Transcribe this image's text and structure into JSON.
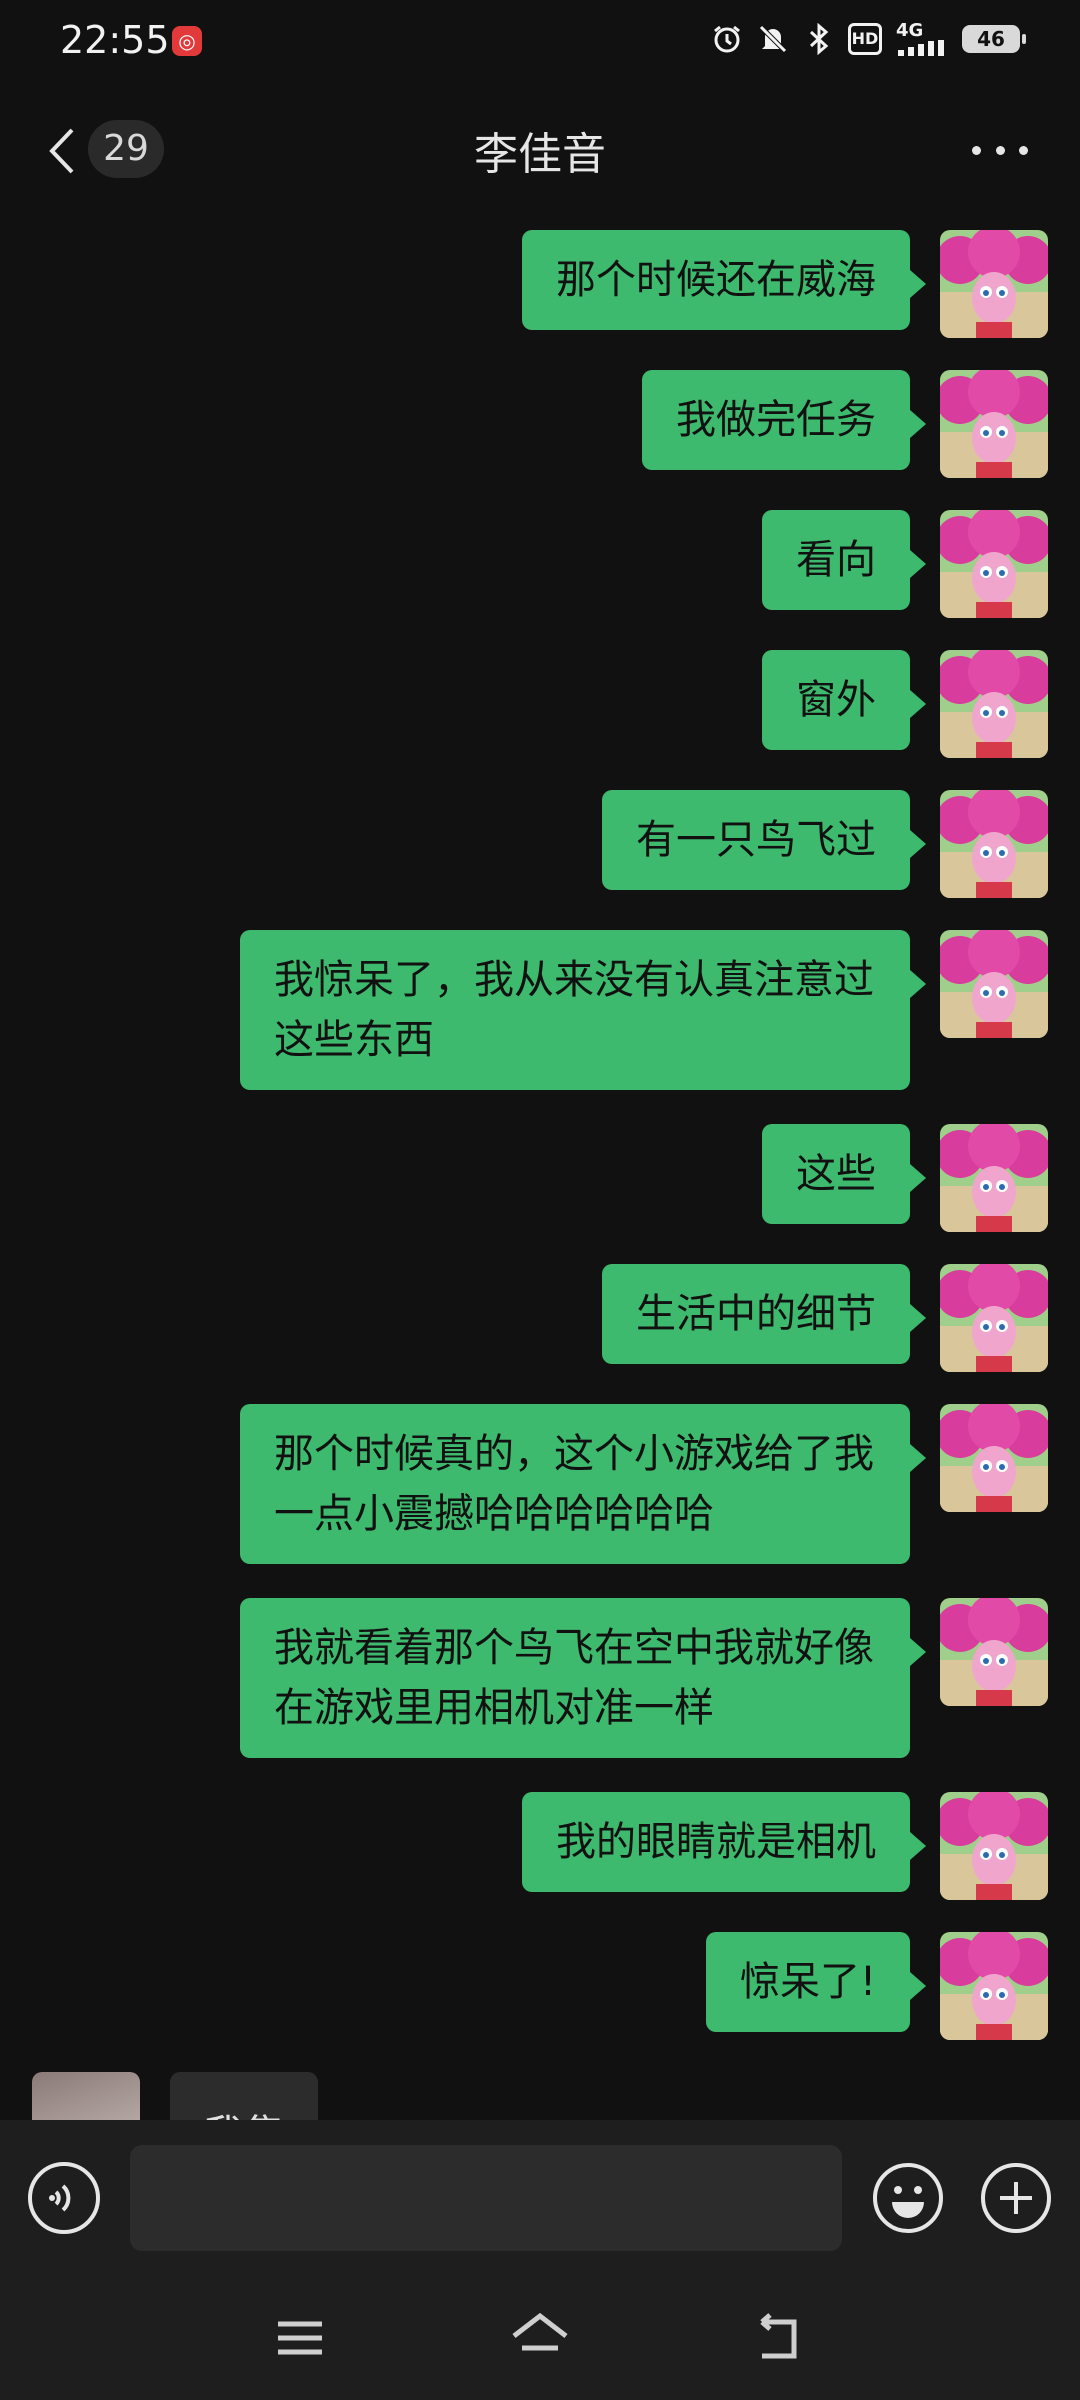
{
  "status_bar": {
    "time": "22:55",
    "network": "4G",
    "hd": "HD",
    "battery": "46"
  },
  "header": {
    "unread_count": "29",
    "title": "李佳音"
  },
  "messages": [
    {
      "text": "那个时候还在威海"
    },
    {
      "text": "我做完任务"
    },
    {
      "text": "看向"
    },
    {
      "text": "窗外"
    },
    {
      "text": "有一只鸟飞过"
    },
    {
      "text": "我惊呆了，我从来没有认真注意过这些东西"
    },
    {
      "text": "这些"
    },
    {
      "text": "生活中的细节"
    },
    {
      "text": "那个时候真的，这个小游戏给了我一点小震撼哈哈哈哈哈哈"
    },
    {
      "text": "我就看着那个鸟飞在空中我就好像在游戏里用相机对准一样"
    },
    {
      "text": "我的眼睛就是相机"
    },
    {
      "text": "惊呆了!"
    }
  ],
  "incoming_partial": {
    "text": "我集"
  },
  "input": {
    "value": ""
  },
  "colors": {
    "background": "#111111",
    "bubble_sent": "#3dba6e",
    "bubble_received": "#2c2c2c",
    "bar": "#1e1e1e"
  }
}
